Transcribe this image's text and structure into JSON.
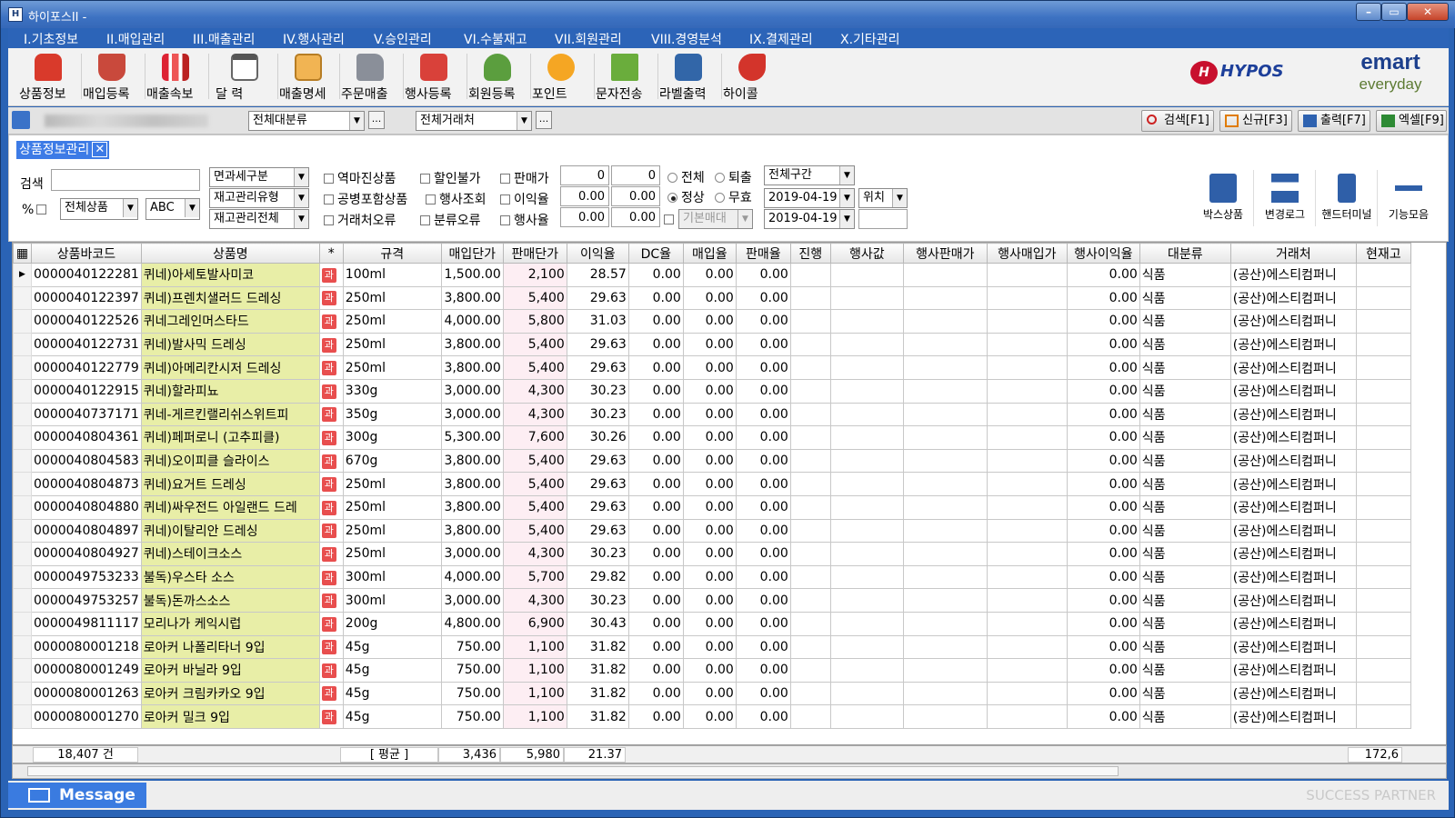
{
  "window": {
    "title": "하이포스II -"
  },
  "menu": [
    "I.기초정보",
    "II.매입관리",
    "III.매출관리",
    "IV.행사관리",
    "V.승인관리",
    "VI.수불재고",
    "VII.회원관리",
    "VIII.경영분석",
    "IX.결제관리",
    "X.기타관리"
  ],
  "toolbar": [
    "상품정보",
    "매입등록",
    "매출속보",
    "달 력",
    "매출명세",
    "주문매출",
    "행사등록",
    "회원등록",
    "포인트",
    "문자전송",
    "라벨출력",
    "하이콜"
  ],
  "brand": {
    "hypos": "HYPOS",
    "emart": "emart",
    "everyday": "everyday"
  },
  "filterbar": {
    "category": "전체대분류",
    "vendor": "전체거래처",
    "dots": "...",
    "search": "검색[F1]",
    "new": "신규[F3]",
    "print": "출력[F7]",
    "excel": "엑셀[F9]"
  },
  "panel": {
    "tab": "상품정보관리",
    "search_label": "검색",
    "search_value": "",
    "percent_label": "%",
    "product_scope": "전체상품",
    "abc": "ABC",
    "tax_type": "면과세구분",
    "stock_type": "재고관리유형",
    "stock_scope": "재고관리전체",
    "checks": [
      "역마진상품",
      "할인불가",
      "공병포함상품",
      "행사조회",
      "거래처오류",
      "분류오류"
    ],
    "sale_price_label": "판매가",
    "profit_label": "이익율",
    "event_label": "행사율",
    "sale_price": [
      "0",
      "0"
    ],
    "profit": [
      "0.00",
      "0.00"
    ],
    "event": [
      "0.00",
      "0.00"
    ],
    "base_label": "기본매대",
    "radio1": [
      "전체",
      "퇴출"
    ],
    "radio2": [
      "정상",
      "무효"
    ],
    "period": "전체구간",
    "date_from": "2019-04-19",
    "date_to": "2019-04-19",
    "location": "위치",
    "location_value": "",
    "right_buttons": [
      "박스상품",
      "변경로그",
      "핸드터미널",
      "기능모음"
    ]
  },
  "grid": {
    "columns": [
      "상품바코드",
      "상품명",
      "*",
      "규격",
      "매입단가",
      "판매단가",
      "이익율",
      "DC율",
      "매입율",
      "판매율",
      "진행",
      "행사값",
      "행사판매가",
      "행사매입가",
      "행사이익율",
      "대분류",
      "거래처",
      "현재고"
    ],
    "tax_badge": "과",
    "rows": [
      [
        "0000040122281",
        "퀴네)아세토발사미코",
        "100ml",
        "1,500.00",
        "2,100",
        "28.57",
        "0.00",
        "0.00",
        "0.00",
        "",
        "",
        "",
        "",
        "0.00",
        "식품",
        "(공산)에스티컴퍼니",
        ""
      ],
      [
        "0000040122397",
        "퀴네)프렌치샐러드 드레싱",
        "250ml",
        "3,800.00",
        "5,400",
        "29.63",
        "0.00",
        "0.00",
        "0.00",
        "",
        "",
        "",
        "",
        "0.00",
        "식품",
        "(공산)에스티컴퍼니",
        ""
      ],
      [
        "0000040122526",
        "퀴네그레인머스타드",
        "250ml",
        "4,000.00",
        "5,800",
        "31.03",
        "0.00",
        "0.00",
        "0.00",
        "",
        "",
        "",
        "",
        "0.00",
        "식품",
        "(공산)에스티컴퍼니",
        ""
      ],
      [
        "0000040122731",
        "퀴네)발사믹 드레싱",
        "250ml",
        "3,800.00",
        "5,400",
        "29.63",
        "0.00",
        "0.00",
        "0.00",
        "",
        "",
        "",
        "",
        "0.00",
        "식품",
        "(공산)에스티컴퍼니",
        ""
      ],
      [
        "0000040122779",
        "퀴네)아메리칸시저 드레싱",
        "250ml",
        "3,800.00",
        "5,400",
        "29.63",
        "0.00",
        "0.00",
        "0.00",
        "",
        "",
        "",
        "",
        "0.00",
        "식품",
        "(공산)에스티컴퍼니",
        ""
      ],
      [
        "0000040122915",
        "퀴네)할라피뇨",
        "330g",
        "3,000.00",
        "4,300",
        "30.23",
        "0.00",
        "0.00",
        "0.00",
        "",
        "",
        "",
        "",
        "0.00",
        "식품",
        "(공산)에스티컴퍼니",
        ""
      ],
      [
        "0000040737171",
        "퀴네-게르킨랠리쉬스위트피",
        "350g",
        "3,000.00",
        "4,300",
        "30.23",
        "0.00",
        "0.00",
        "0.00",
        "",
        "",
        "",
        "",
        "0.00",
        "식품",
        "(공산)에스티컴퍼니",
        ""
      ],
      [
        "0000040804361",
        "퀴네)페퍼로니 (고추피클)",
        "300g",
        "5,300.00",
        "7,600",
        "30.26",
        "0.00",
        "0.00",
        "0.00",
        "",
        "",
        "",
        "",
        "0.00",
        "식품",
        "(공산)에스티컴퍼니",
        ""
      ],
      [
        "0000040804583",
        "퀴네)오이피클 슬라이스",
        "670g",
        "3,800.00",
        "5,400",
        "29.63",
        "0.00",
        "0.00",
        "0.00",
        "",
        "",
        "",
        "",
        "0.00",
        "식품",
        "(공산)에스티컴퍼니",
        ""
      ],
      [
        "0000040804873",
        "퀴네)요거트 드레싱",
        "250ml",
        "3,800.00",
        "5,400",
        "29.63",
        "0.00",
        "0.00",
        "0.00",
        "",
        "",
        "",
        "",
        "0.00",
        "식품",
        "(공산)에스티컴퍼니",
        ""
      ],
      [
        "0000040804880",
        "퀴네)싸우전드 아일랜드 드레",
        "250ml",
        "3,800.00",
        "5,400",
        "29.63",
        "0.00",
        "0.00",
        "0.00",
        "",
        "",
        "",
        "",
        "0.00",
        "식품",
        "(공산)에스티컴퍼니",
        ""
      ],
      [
        "0000040804897",
        "퀴네)이탈리안 드레싱",
        "250ml",
        "3,800.00",
        "5,400",
        "29.63",
        "0.00",
        "0.00",
        "0.00",
        "",
        "",
        "",
        "",
        "0.00",
        "식품",
        "(공산)에스티컴퍼니",
        ""
      ],
      [
        "0000040804927",
        "퀴네)스테이크소스",
        "250ml",
        "3,000.00",
        "4,300",
        "30.23",
        "0.00",
        "0.00",
        "0.00",
        "",
        "",
        "",
        "",
        "0.00",
        "식품",
        "(공산)에스티컴퍼니",
        ""
      ],
      [
        "0000049753233",
        "불독)우스타 소스",
        "300ml",
        "4,000.00",
        "5,700",
        "29.82",
        "0.00",
        "0.00",
        "0.00",
        "",
        "",
        "",
        "",
        "0.00",
        "식품",
        "(공산)에스티컴퍼니",
        ""
      ],
      [
        "0000049753257",
        "불독)돈까스소스",
        "300ml",
        "3,000.00",
        "4,300",
        "30.23",
        "0.00",
        "0.00",
        "0.00",
        "",
        "",
        "",
        "",
        "0.00",
        "식품",
        "(공산)에스티컴퍼니",
        ""
      ],
      [
        "0000049811117",
        "모리나가 케익시럽",
        "200g",
        "4,800.00",
        "6,900",
        "30.43",
        "0.00",
        "0.00",
        "0.00",
        "",
        "",
        "",
        "",
        "0.00",
        "식품",
        "(공산)에스티컴퍼니",
        ""
      ],
      [
        "0000080001218",
        "로아커 나폴리타너 9입",
        "45g",
        "750.00",
        "1,100",
        "31.82",
        "0.00",
        "0.00",
        "0.00",
        "",
        "",
        "",
        "",
        "0.00",
        "식품",
        "(공산)에스티컴퍼니",
        ""
      ],
      [
        "0000080001249",
        "로아커 바닐라 9입",
        "45g",
        "750.00",
        "1,100",
        "31.82",
        "0.00",
        "0.00",
        "0.00",
        "",
        "",
        "",
        "",
        "0.00",
        "식품",
        "(공산)에스티컴퍼니",
        ""
      ],
      [
        "0000080001263",
        "로아커 크림카카오 9입",
        "45g",
        "750.00",
        "1,100",
        "31.82",
        "0.00",
        "0.00",
        "0.00",
        "",
        "",
        "",
        "",
        "0.00",
        "식품",
        "(공산)에스티컴퍼니",
        ""
      ],
      [
        "0000080001270",
        "로아커 밀크 9입",
        "45g",
        "750.00",
        "1,100",
        "31.82",
        "0.00",
        "0.00",
        "0.00",
        "",
        "",
        "",
        "",
        "0.00",
        "식품",
        "(공산)에스티컴퍼니",
        ""
      ]
    ]
  },
  "summary": {
    "count": "18,407 건",
    "avg_label": "[ 평균 ]",
    "avg_buy": "3,436",
    "avg_sell": "5,980",
    "avg_profit": "21.37",
    "stock": "172,6"
  },
  "status": {
    "message": "Message",
    "tagline": "SUCCESS PARTNER"
  }
}
